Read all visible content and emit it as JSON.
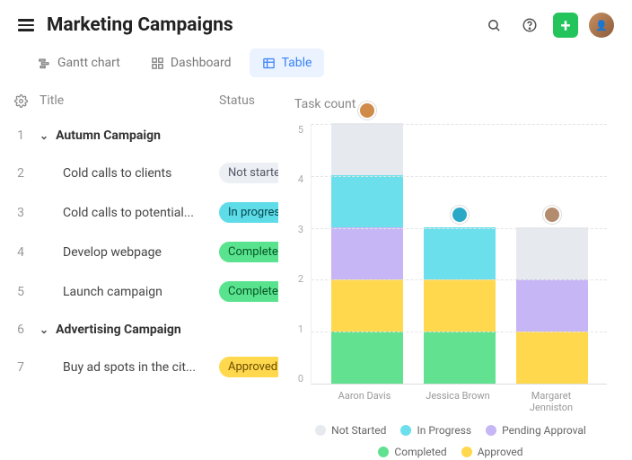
{
  "header": {
    "title": "Marketing Campaigns"
  },
  "tabs": [
    {
      "id": "gantt",
      "label": "Gantt chart",
      "active": false
    },
    {
      "id": "dashboard",
      "label": "Dashboard",
      "active": false
    },
    {
      "id": "table",
      "label": "Table",
      "active": true
    }
  ],
  "table": {
    "col_title": "Title",
    "col_status": "Status",
    "rows": [
      {
        "num": "1",
        "title": "Autumn Campaign",
        "group": true
      },
      {
        "num": "2",
        "title": "Cold calls to clients",
        "status": "Not started",
        "status_key": "not-started"
      },
      {
        "num": "3",
        "title": "Cold calls to potential...",
        "status": "In progress",
        "status_key": "in-progress"
      },
      {
        "num": "4",
        "title": "Develop webpage",
        "status": "Completed",
        "status_key": "completed"
      },
      {
        "num": "5",
        "title": "Launch campaign",
        "status": "Completed",
        "status_key": "completed"
      },
      {
        "num": "6",
        "title": "Advertising Campaign",
        "group": true
      },
      {
        "num": "7",
        "title": "Buy ad spots in the cit...",
        "status": "Approved",
        "status_key": "approved"
      }
    ]
  },
  "chart_data": {
    "type": "bar",
    "title": "Task count",
    "ylabel": "",
    "ylim": [
      0,
      5
    ],
    "ticks": [
      "5",
      "4",
      "3",
      "2",
      "1",
      "0"
    ],
    "categories": [
      "Aaron Davis",
      "Jessica Brown",
      "Margaret Jenniston"
    ],
    "avatars": [
      "#d08a4a",
      "#2aa9c7",
      "#b38b6d"
    ],
    "series": [
      {
        "name": "Not Started",
        "key": "not-started",
        "color": "#e6eaef",
        "values": [
          1,
          0,
          1
        ]
      },
      {
        "name": "In Progress",
        "key": "in-progress",
        "color": "#6be0ec",
        "values": [
          1,
          1,
          0
        ]
      },
      {
        "name": "Pending Approval",
        "key": "pending",
        "color": "#c7b6f5",
        "values": [
          1,
          0,
          1
        ]
      },
      {
        "name": "Completed",
        "key": "completed",
        "color": "#62e191",
        "values": [
          1,
          1,
          0
        ]
      },
      {
        "name": "Approved",
        "key": "approved",
        "color": "#ffd84d",
        "values": [
          1,
          1,
          1
        ]
      }
    ],
    "legend": [
      {
        "label": "Not Started",
        "color": "#e6eaef"
      },
      {
        "label": "In Progress",
        "color": "#6be0ec"
      },
      {
        "label": "Pending Approval",
        "color": "#c7b6f5"
      },
      {
        "label": "Completed",
        "color": "#62e191"
      },
      {
        "label": "Approved",
        "color": "#ffd84d"
      }
    ]
  }
}
